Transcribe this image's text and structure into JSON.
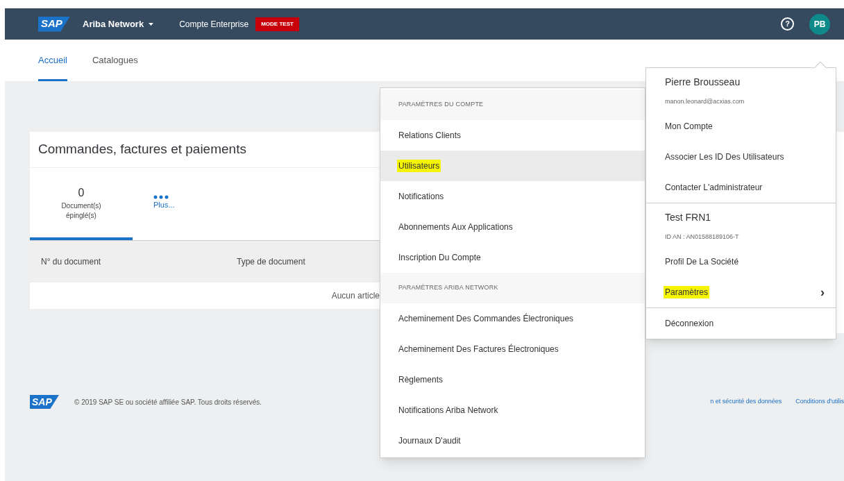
{
  "header": {
    "logo": "SAP",
    "product": "Ariba Network",
    "account": "Compte Enterprise",
    "badge": "MODE TEST",
    "help": "?",
    "avatar": "PB"
  },
  "tabs": [
    {
      "label": "Accueil",
      "selected": true
    },
    {
      "label": "Catalogues",
      "selected": false
    }
  ],
  "card": {
    "title": "Commandes, factures et paiements",
    "tiles": [
      {
        "kind": "count",
        "value": "0",
        "label": "Document(s) épinglé(s)",
        "selected": true
      },
      {
        "kind": "more",
        "label": "Plus...",
        "selected": false
      }
    ],
    "columns": [
      "N° du document",
      "Type de document"
    ],
    "empty": "Aucun article"
  },
  "footer": {
    "logo": "SAP",
    "copyright": "© 2019 SAP SE ou société affiliée SAP. Tous droits réservés.",
    "links": [
      "n et sécurité des données",
      "Conditions d'utilis"
    ]
  },
  "settings_menu": [
    {
      "kind": "header",
      "label": "PARAMÈTRES DU COMPTE"
    },
    {
      "kind": "item",
      "label": "Relations Clients",
      "selected": false,
      "highlighted": false
    },
    {
      "kind": "item",
      "label": "Utilisateurs",
      "selected": true,
      "highlighted": true
    },
    {
      "kind": "item",
      "label": "Notifications",
      "selected": false,
      "highlighted": false
    },
    {
      "kind": "item",
      "label": "Abonnements Aux Applications",
      "selected": false,
      "highlighted": false
    },
    {
      "kind": "item",
      "label": "Inscription Du Compte",
      "selected": false,
      "highlighted": false
    },
    {
      "kind": "header",
      "label": "PARAMÈTRES ARIBA NETWORK"
    },
    {
      "kind": "item",
      "label": "Acheminement Des Commandes Électroniques",
      "selected": false,
      "highlighted": false
    },
    {
      "kind": "item",
      "label": "Acheminement Des Factures Électroniques",
      "selected": false,
      "highlighted": false
    },
    {
      "kind": "item",
      "label": "Règlements",
      "selected": false,
      "highlighted": false
    },
    {
      "kind": "item",
      "label": "Notifications Ariba Network",
      "selected": false,
      "highlighted": false
    },
    {
      "kind": "item",
      "label": "Journaux D'audit",
      "selected": false,
      "highlighted": false
    }
  ],
  "profile_menu": [
    {
      "kind": "name",
      "label": "Pierre Brousseau"
    },
    {
      "kind": "sub",
      "label": "manon.leonard@acxias.com"
    },
    {
      "kind": "item",
      "label": "Mon Compte",
      "highlighted": false
    },
    {
      "kind": "item",
      "label": "Associer Les ID Des Utilisateurs",
      "highlighted": false
    },
    {
      "kind": "item",
      "label": "Contacter L'administrateur",
      "highlighted": false
    },
    {
      "kind": "divider"
    },
    {
      "kind": "name",
      "label": "Test FRN1"
    },
    {
      "kind": "sub",
      "label": "ID AN : AN01588189106-T"
    },
    {
      "kind": "item",
      "label": "Profil De La Société",
      "highlighted": false
    },
    {
      "kind": "submenu",
      "label": "Paramètres",
      "chevron": "›",
      "highlighted": true
    },
    {
      "kind": "divider"
    },
    {
      "kind": "item",
      "label": "Déconnexion",
      "highlighted": false
    }
  ]
}
